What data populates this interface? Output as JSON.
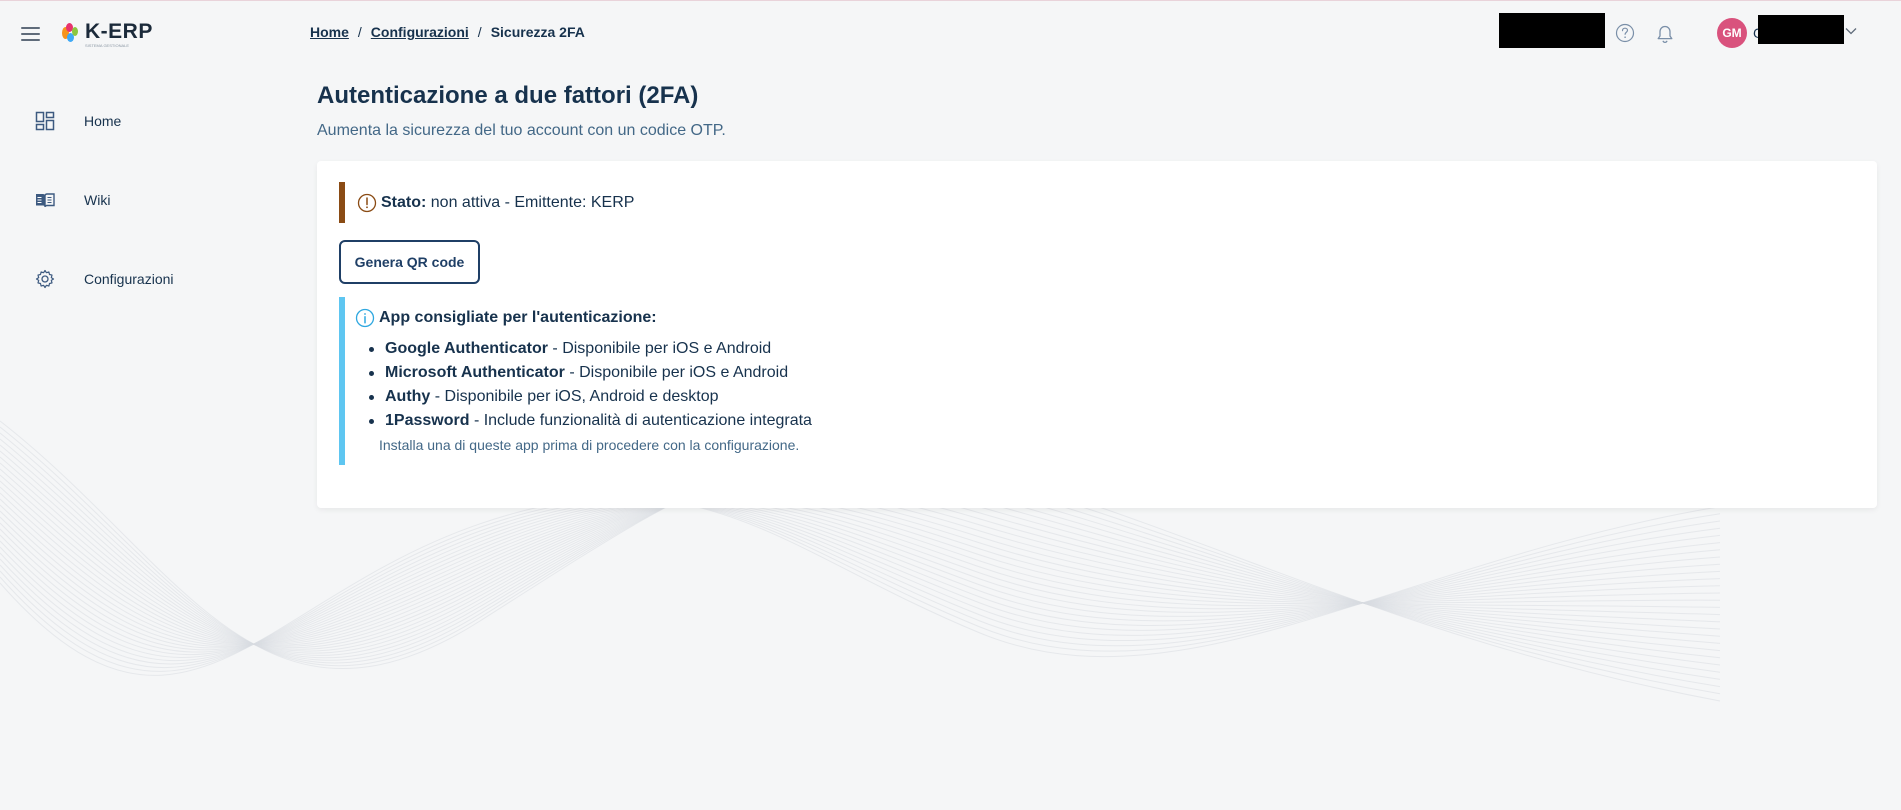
{
  "app": {
    "logo_text": "K-ERP",
    "logo_sub": "SISTEMA GESTIONALE"
  },
  "breadcrumb": {
    "items": [
      "Home",
      "Configurazioni"
    ],
    "separator": "/",
    "current": "Sicurezza 2FA"
  },
  "header": {
    "help_icon": "help-circle-icon",
    "bell_icon": "bell-icon",
    "user_initials": "GM",
    "user_name_initial": "G",
    "avatar_color": "#d9527d"
  },
  "sidebar": {
    "items": [
      {
        "label": "Home",
        "icon": "dashboard-icon"
      },
      {
        "label": "Wiki",
        "icon": "book-icon"
      },
      {
        "label": "Configurazioni",
        "icon": "gear-icon"
      }
    ]
  },
  "main": {
    "title": "Autenticazione a due fattori (2FA)",
    "subtitle": "Aumenta la sicurezza del tuo account con un codice OTP.",
    "status": {
      "label": "Stato:",
      "value": "non attiva - Emittente: KERP",
      "accent_color": "#8a4b14"
    },
    "qr_button": "Genera QR code",
    "info": {
      "heading": "App consigliate per l'autenticazione:",
      "accent_color": "#5ec6f1",
      "apps": [
        {
          "name": "Google Authenticator",
          "desc": "- Disponibile per iOS e Android"
        },
        {
          "name": "Microsoft Authenticator",
          "desc": "- Disponibile per iOS e Android"
        },
        {
          "name": "Authy",
          "desc": "- Disponibile per iOS, Android e desktop"
        },
        {
          "name": "1Password",
          "desc": "- Include funzionalità di autenticazione integrata"
        }
      ],
      "note": "Installa una di queste app prima di procedere con la configurazione."
    }
  }
}
